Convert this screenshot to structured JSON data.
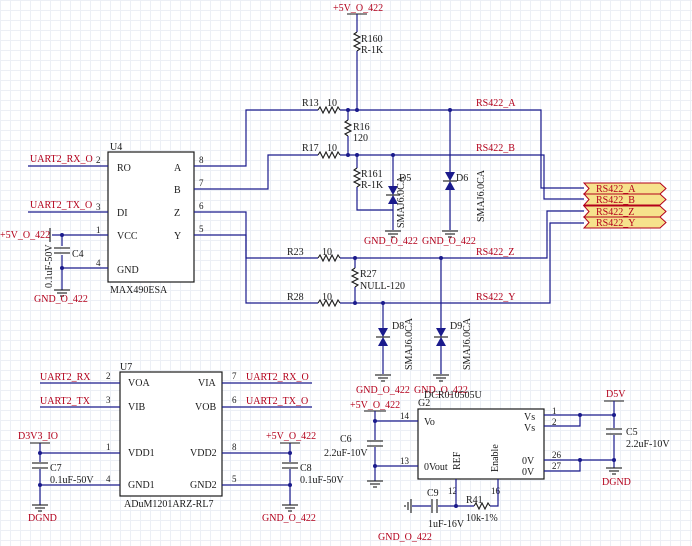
{
  "colors": {
    "wire": "#1a1a8c",
    "net_label": "#b3001b",
    "connector": "#f6e28c"
  },
  "nets": {
    "p5v_top": "+5V_O_422",
    "gnd_left": "GND_O_422",
    "p5v_left": "+5V_O_422",
    "uart_rx_u4": "UART2_RX_O",
    "uart_tx_u4": "UART2_TX_O",
    "rs_a": "RS422_A",
    "rs_b": "RS422_B",
    "rs_z": "RS422_Z",
    "rs_y": "RS422_Y",
    "gnd_d5": "GND_O_422",
    "gnd_d6": "GND_O_422",
    "gnd_d8": "GND_O_422",
    "gnd_d9": "GND_O_422",
    "uart_rx_u7l": "UART2_RX",
    "uart_tx_u7l": "UART2_TX",
    "uart_rx_u7r": "UART2_RX_O",
    "uart_tx_u7r": "UART2_TX_O",
    "d3v3": "D3V3_IO",
    "dgnd_left": "DGND",
    "p5v_u7": "+5V_O_422",
    "gnd_u7": "GND_O_422",
    "p5v_g2": "+5V_O_422",
    "gnd_g2": "GND_O_422",
    "d5v": "D5V",
    "dgnd_right": "DGND"
  },
  "connector": [
    "RS422_A",
    "RS422_B",
    "RS422_Z",
    "RS422_Y"
  ],
  "u4": {
    "ref": "U4",
    "part": "MAX490ESA",
    "pins": {
      "ro": "RO",
      "di": "DI",
      "vcc": "VCC",
      "gnd": "GND",
      "a": "A",
      "b": "B",
      "z": "Z",
      "y": "Y"
    },
    "nums": {
      "ro": "2",
      "di": "3",
      "vcc": "1",
      "gnd": "4",
      "a": "8",
      "b": "7",
      "z": "6",
      "y": "5"
    }
  },
  "u7": {
    "ref": "U7",
    "part": "ADuM1201ARZ-RL7",
    "pins": {
      "voa": "VOA",
      "vib": "VIB",
      "vdd1": "VDD1",
      "gnd1": "GND1",
      "via": "VIA",
      "vob": "VOB",
      "vdd2": "VDD2",
      "gnd2": "GND2"
    },
    "nums": {
      "voa": "2",
      "vib": "3",
      "vdd1": "1",
      "gnd1": "4",
      "via": "7",
      "vob": "6",
      "vdd2": "8",
      "gnd2": "5"
    }
  },
  "g2": {
    "ref": "G2",
    "part": "DCR010505U",
    "pins": {
      "vo": "Vo",
      "vout0": "0Vout",
      "ref": "REF",
      "enable": "Enable",
      "vs1": "Vs",
      "vs2": "Vs",
      "ov1": "0V",
      "ov2": "0V"
    },
    "nums": {
      "vo": "14",
      "vout0": "13",
      "ref": "12",
      "enable": "16",
      "vs1": "1",
      "vs2": "2",
      "ov1": "26",
      "ov2": "27"
    }
  },
  "resistors": {
    "r160": {
      "ref": "R160",
      "val": "R-1K"
    },
    "r13": {
      "ref": "R13",
      "val": "10"
    },
    "r16": {
      "ref": "R16",
      "val": "120"
    },
    "r17": {
      "ref": "R17",
      "val": "10"
    },
    "r161": {
      "ref": "R161",
      "val": "R-1K"
    },
    "r23": {
      "ref": "R23",
      "val": "10"
    },
    "r27": {
      "ref": "R27",
      "val": "NULL-120"
    },
    "r28": {
      "ref": "R28",
      "val": "10"
    },
    "r41": {
      "ref": "R41",
      "val": "10k-1%"
    }
  },
  "caps": {
    "c4": {
      "ref": "C4",
      "val": "0.1uF-50V"
    },
    "c7": {
      "ref": "C7",
      "val": "0.1uF-50V"
    },
    "c8": {
      "ref": "C8",
      "val": "0.1uF-50V"
    },
    "c6": {
      "ref": "C6",
      "val": "2.2uF-10V"
    },
    "c5": {
      "ref": "C5",
      "val": "2.2uF-10V"
    },
    "c9": {
      "ref": "C9",
      "val": "1uF-16V"
    }
  },
  "diodes": {
    "d5": {
      "ref": "D5",
      "val": "SMAJ6.0CA"
    },
    "d6": {
      "ref": "D6",
      "val": "SMAJ6.0CA"
    },
    "d8": {
      "ref": "D8",
      "val": "SMAJ6.0CA"
    },
    "d9": {
      "ref": "D9",
      "val": "SMAJ6.0CA"
    }
  }
}
